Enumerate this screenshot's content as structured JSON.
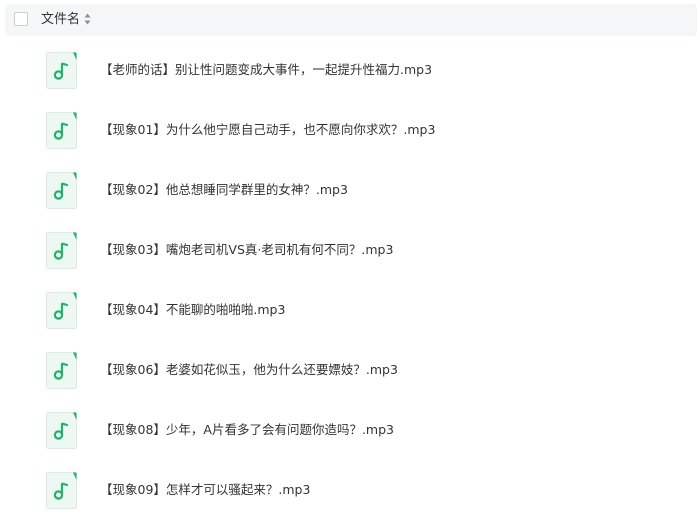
{
  "header": {
    "column_title": "文件名",
    "sort_icon": "sort-updown-icon"
  },
  "file_icon": "music-note-icon",
  "colors": {
    "header_bg": "#f5f6f7",
    "icon_bg": "#eef8f3",
    "icon_accent": "#23b26d"
  },
  "files": [
    {
      "name": "【老师的话】别让性问题变成大事件，一起提升性福力.mp3"
    },
    {
      "name": "【现象01】为什么他宁愿自己动手，也不愿向你求欢？.mp3"
    },
    {
      "name": "【现象02】他总想睡同学群里的女神？.mp3"
    },
    {
      "name": "【现象03】嘴炮老司机VS真·老司机有何不同？.mp3"
    },
    {
      "name": "【现象04】不能聊的啪啪啪.mp3"
    },
    {
      "name": "【现象06】老婆如花似玉，他为什么还要嫖妓？.mp3"
    },
    {
      "name": "【现象08】少年，A片看多了会有问题你造吗？.mp3"
    },
    {
      "name": "【现象09】怎样才可以骚起来？.mp3"
    }
  ]
}
